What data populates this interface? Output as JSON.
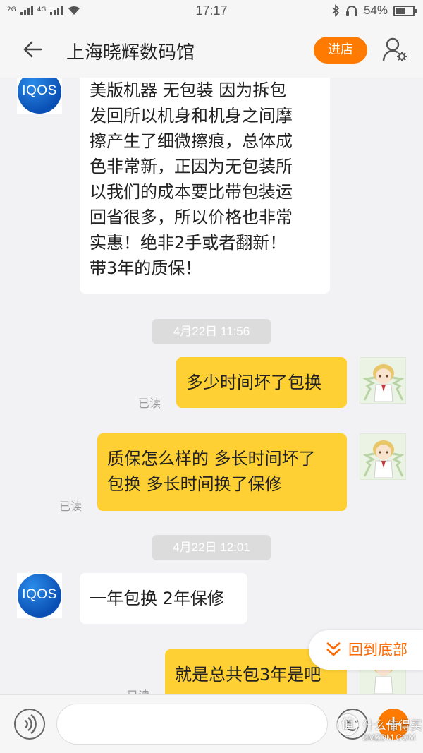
{
  "status_bar": {
    "signal_left": "2G",
    "signal_mid": "4G",
    "time": "17:17",
    "battery": "54%",
    "battery_level": 0.54
  },
  "header": {
    "title": "上海晓辉数码馆",
    "store_button": "进店",
    "back_icon": "back-arrow-icon",
    "profile_icon": "user-settings-icon"
  },
  "messages": [
    {
      "side": "left",
      "sender_avatar": "IQOS",
      "lines": [
        "美版机器 无包装 因为拆包",
        "发回所以机身和机身之间摩",
        "擦产生了细微擦痕，总体成",
        "色非常新，正因为无包装所",
        "以我们的成本要比带包装运",
        "回省很多，所以价格也非常",
        "实惠！绝非2手或者翻新！",
        "带3年的质保！"
      ]
    },
    {
      "type": "time",
      "text": "4月22日 11:56"
    },
    {
      "side": "right",
      "lines": [
        "多少时间坏了包换"
      ],
      "read": "已读"
    },
    {
      "side": "right",
      "lines": [
        "质保怎么样的 多长时间坏了",
        "包换 多长时间换了保修"
      ],
      "read": "已读"
    },
    {
      "type": "time",
      "text": "4月22日 12:01"
    },
    {
      "side": "left",
      "sender_avatar": "IQOS",
      "lines": [
        "一年包换 2年保修"
      ]
    },
    {
      "side": "right",
      "lines": [
        "就是总共包3年是吧"
      ],
      "read": "已读"
    }
  ],
  "back_to_bottom": "回到底部",
  "input_bar": {
    "voice_icon": "voice-icon",
    "emoji_icon": "emoji-icon",
    "plus_label": "+"
  },
  "watermark": {
    "cn": "什么值得买",
    "en": "SMZDM.COM",
    "logo": "值"
  },
  "colors": {
    "accent": "#ff7a00",
    "bubble_self": "#ffd034",
    "bubble_other": "#ffffff",
    "background": "#f2f2f4"
  }
}
